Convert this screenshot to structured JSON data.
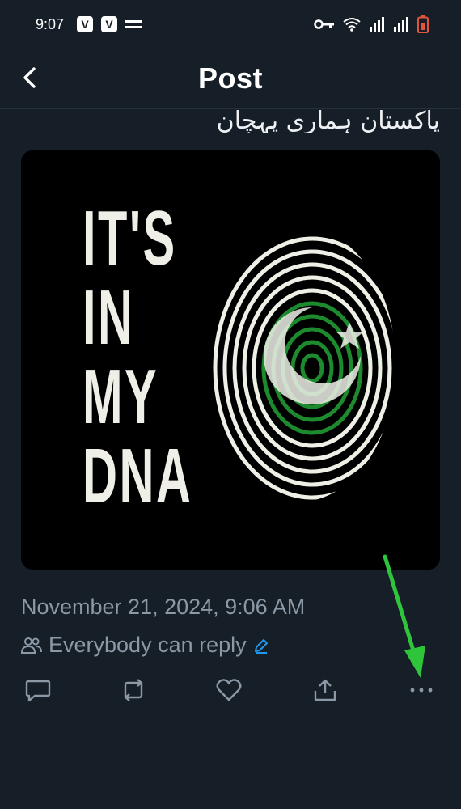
{
  "status_bar": {
    "time": "9:07",
    "badges": [
      "V",
      "V"
    ],
    "icons": [
      "key-icon",
      "wifi-icon",
      "signal-icon",
      "signal-icon",
      "battery-icon"
    ]
  },
  "header": {
    "title": "Post",
    "back_icon": "chevron-left-icon"
  },
  "post": {
    "text": "پاکستان ہماری پہچان",
    "image": {
      "lines": [
        "IT'S",
        "IN",
        "MY",
        "DNA"
      ]
    },
    "timestamp": "November 21, 2024, 9:06 AM",
    "reply_setting": "Everybody can reply",
    "actions": [
      {
        "name": "reply",
        "icon": "comment-icon"
      },
      {
        "name": "repost",
        "icon": "repost-icon"
      },
      {
        "name": "like",
        "icon": "heart-icon"
      },
      {
        "name": "share",
        "icon": "share-icon"
      },
      {
        "name": "more",
        "icon": "more-icon"
      }
    ]
  },
  "colors": {
    "background": "#161e27",
    "secondary_text": "#8b98a5",
    "accent": "#1d9bf0",
    "flag_green": "#1e8a2e",
    "annotation_arrow": "#2fc53a"
  }
}
